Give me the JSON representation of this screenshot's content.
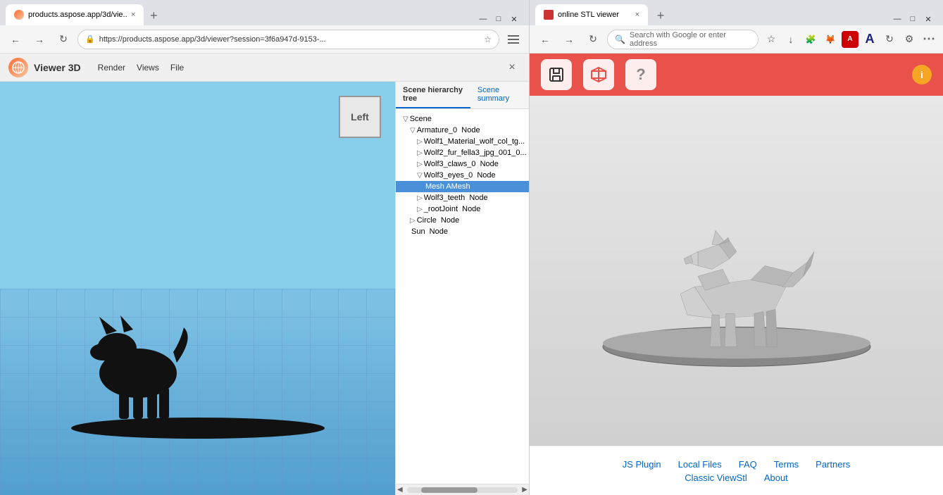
{
  "left_browser": {
    "tab": {
      "label": "products.aspose.app/3d/vie...",
      "favicon": "3d-favicon"
    },
    "address": "https://products.aspose.app/3d/viewer?session=3f6a947d-9153-...",
    "viewer_app": {
      "title": "Viewer 3D",
      "menus": [
        "Render",
        "Views",
        "File"
      ],
      "close_label": "×",
      "cube_label": "Left",
      "scene_tabs": [
        "Scene hierarchy tree",
        "Scene summary"
      ],
      "tree_items": [
        {
          "label": "Scene",
          "indent": 0,
          "arrow": "▽",
          "type": "group"
        },
        {
          "label": "Armature_0  Node",
          "indent": 1,
          "arrow": "▽",
          "type": "node"
        },
        {
          "label": "Wolf1_Material_wolf_col_tg...",
          "indent": 2,
          "arrow": "▷",
          "type": "node"
        },
        {
          "label": "Wolf2_fur_fella3_jpg_001_0...",
          "indent": 2,
          "arrow": "▷",
          "type": "node"
        },
        {
          "label": "Wolf3_claws_0  Node",
          "indent": 2,
          "arrow": "▷",
          "type": "node"
        },
        {
          "label": "Wolf3_eyes_0  Node",
          "indent": 2,
          "arrow": "▽",
          "type": "node"
        },
        {
          "label": "Mesh AMesh",
          "indent": 3,
          "arrow": "",
          "type": "mesh",
          "selected": true
        },
        {
          "label": "Wolf3_teeth  Node",
          "indent": 2,
          "arrow": "▷",
          "type": "node"
        },
        {
          "label": "_rootJoint  Node",
          "indent": 2,
          "arrow": "▷",
          "type": "node"
        },
        {
          "label": "Circle  Node",
          "indent": 1,
          "arrow": "▷",
          "type": "node"
        },
        {
          "label": "Sun  Node",
          "indent": 1,
          "arrow": "",
          "type": "node"
        }
      ]
    }
  },
  "right_browser": {
    "tab": {
      "label": "online STL viewer",
      "favicon": "stl-favicon"
    },
    "address": "Search with Google or enter address",
    "toolbar": {
      "save_icon": "💾",
      "box_icon": "📦",
      "help_icon": "❓",
      "info_label": "i"
    },
    "footer": {
      "row1": [
        "JS Plugin",
        "Local Files",
        "FAQ",
        "Terms",
        "Partners"
      ],
      "row2": [
        "Classic ViewStl",
        "About"
      ]
    }
  },
  "colors": {
    "stl_toolbar": "#e8524a",
    "tab_active_bg": "#ffffff",
    "tab_bar_bg": "#dee1e6",
    "address_bg": "#ffffff",
    "selected_tree": "#4a90d9",
    "footer_link": "#0066cc",
    "info_badge": "#f5a623"
  }
}
